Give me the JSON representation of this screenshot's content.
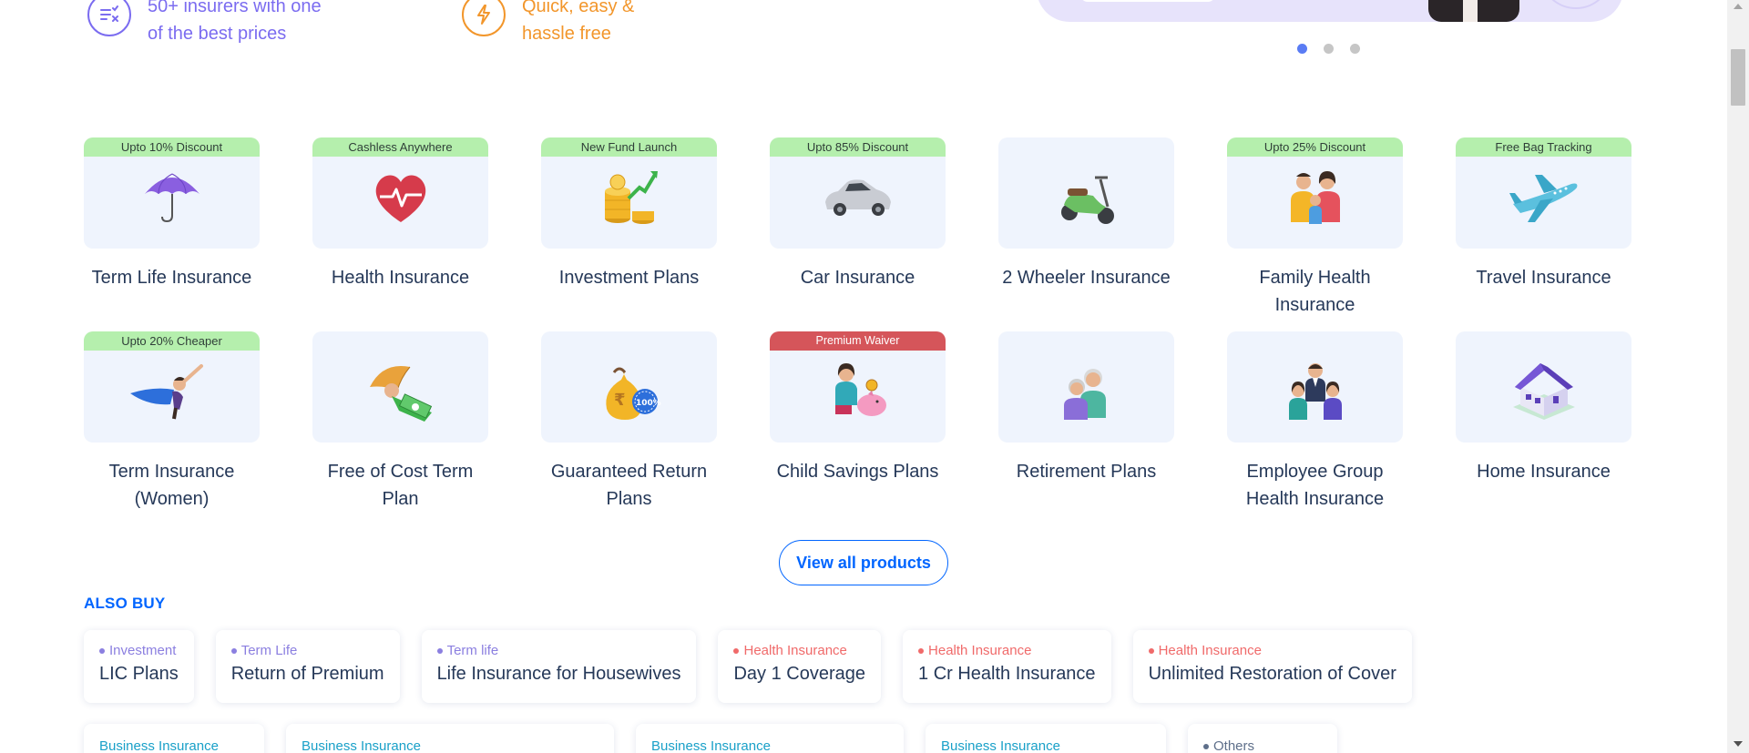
{
  "features": [
    {
      "icon": "compare-list-icon",
      "line1": "50+ insurers with one",
      "line2": "of the best prices",
      "color": "#7b6cf0"
    },
    {
      "icon": "lightning-icon",
      "line1": "Quick, easy &",
      "line2": "hassle free",
      "color": "#f2962b"
    }
  ],
  "carousel": {
    "active_dot": 0,
    "dot_count": 3
  },
  "products": [
    {
      "name": "Term Life Insurance",
      "badge": "Upto 10% Discount",
      "icon": "umbrella-icon"
    },
    {
      "name": "Health Insurance",
      "badge": "Cashless Anywhere",
      "icon": "heart-pulse-icon"
    },
    {
      "name": "Investment Plans",
      "badge": "New Fund Launch",
      "icon": "coins-growth-icon"
    },
    {
      "name": "Car Insurance",
      "badge": "Upto 85% Discount",
      "icon": "car-icon"
    },
    {
      "name": "2 Wheeler Insurance",
      "badge": "",
      "icon": "scooter-icon"
    },
    {
      "name": "Family Health Insurance",
      "badge": "Upto 25% Discount",
      "icon": "family-icon"
    },
    {
      "name": "Travel Insurance",
      "badge": "Free Bag Tracking",
      "icon": "airplane-icon"
    },
    {
      "name": "Term Insurance (Women)",
      "badge": "Upto 20% Cheaper",
      "icon": "superwoman-icon"
    },
    {
      "name": "Free of Cost Term Plan",
      "badge": "",
      "icon": "umbrella-cash-icon"
    },
    {
      "name": "Guaranteed Return Plans",
      "badge": "",
      "icon": "money-bag-icon"
    },
    {
      "name": "Child Savings Plans",
      "badge": "Premium Waiver",
      "badge_style": "red",
      "icon": "piggy-bank-child-icon"
    },
    {
      "name": "Retirement Plans",
      "badge": "",
      "icon": "elderly-couple-icon"
    },
    {
      "name": "Employee Group Health Insurance",
      "badge": "",
      "icon": "employee-group-icon"
    },
    {
      "name": "Home Insurance",
      "badge": "",
      "icon": "house-icon"
    }
  ],
  "view_all": "View all products",
  "also_buy_title": "ALSO BUY",
  "also_buy": [
    {
      "tag": "Investment",
      "label": "LIC Plans",
      "color": "#8b7fe0"
    },
    {
      "tag": "Term Life",
      "label": "Return of Premium",
      "color": "#8b7fe0"
    },
    {
      "tag": "Term life",
      "label": "Life Insurance for Housewives",
      "color": "#8b7fe0"
    },
    {
      "tag": "Health Insurance",
      "label": "Day 1 Coverage",
      "color": "#f06a6a"
    },
    {
      "tag": "Health Insurance",
      "label": "1 Cr Health Insurance",
      "color": "#f06a6a"
    },
    {
      "tag": "Health Insurance",
      "label": "Unlimited Restoration of Cover",
      "color": "#f06a6a"
    }
  ],
  "also_buy_row2": [
    {
      "tag": "Business Insurance",
      "kind": "biz"
    },
    {
      "tag": "Business Insurance",
      "kind": "biz"
    },
    {
      "tag": "Business Insurance",
      "kind": "biz"
    },
    {
      "tag": "Business Insurance",
      "kind": "biz"
    },
    {
      "tag": "Others",
      "kind": "other"
    }
  ]
}
